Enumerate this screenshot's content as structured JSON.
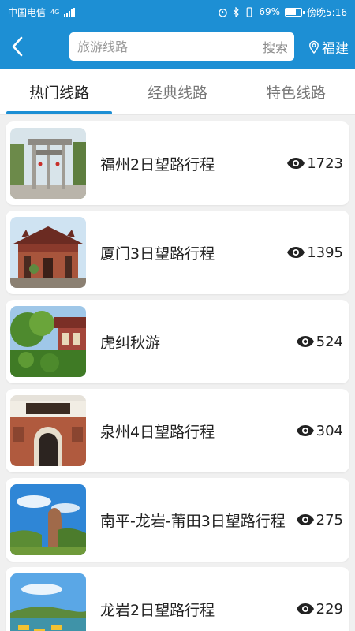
{
  "status_bar": {
    "carrier": "中国电信",
    "network": "4G",
    "battery": "69%",
    "battery_level": 0.69,
    "time": "傍晚5:16"
  },
  "header": {
    "search_placeholder": "旅游线路",
    "search_button": "搜索",
    "location": "福建"
  },
  "tabs": [
    {
      "label": "热门线路",
      "active": true
    },
    {
      "label": "经典线路",
      "active": false
    },
    {
      "label": "特色线路",
      "active": false
    }
  ],
  "routes": [
    {
      "title": "福州2日望路行程",
      "views": "1723"
    },
    {
      "title": "厦门3日望路行程",
      "views": "1395"
    },
    {
      "title": "虎纠秋游",
      "views": "524"
    },
    {
      "title": "泉州4日望路行程",
      "views": "304"
    },
    {
      "title": "南平-龙岩-莆田3日望路行程",
      "views": "275"
    },
    {
      "title": "龙岩2日望路行程",
      "views": "229"
    }
  ],
  "icons": {
    "back": "back-arrow-icon",
    "location": "location-pin-icon",
    "views": "eye-icon"
  },
  "colors": {
    "brand": "#1d8fd4"
  }
}
